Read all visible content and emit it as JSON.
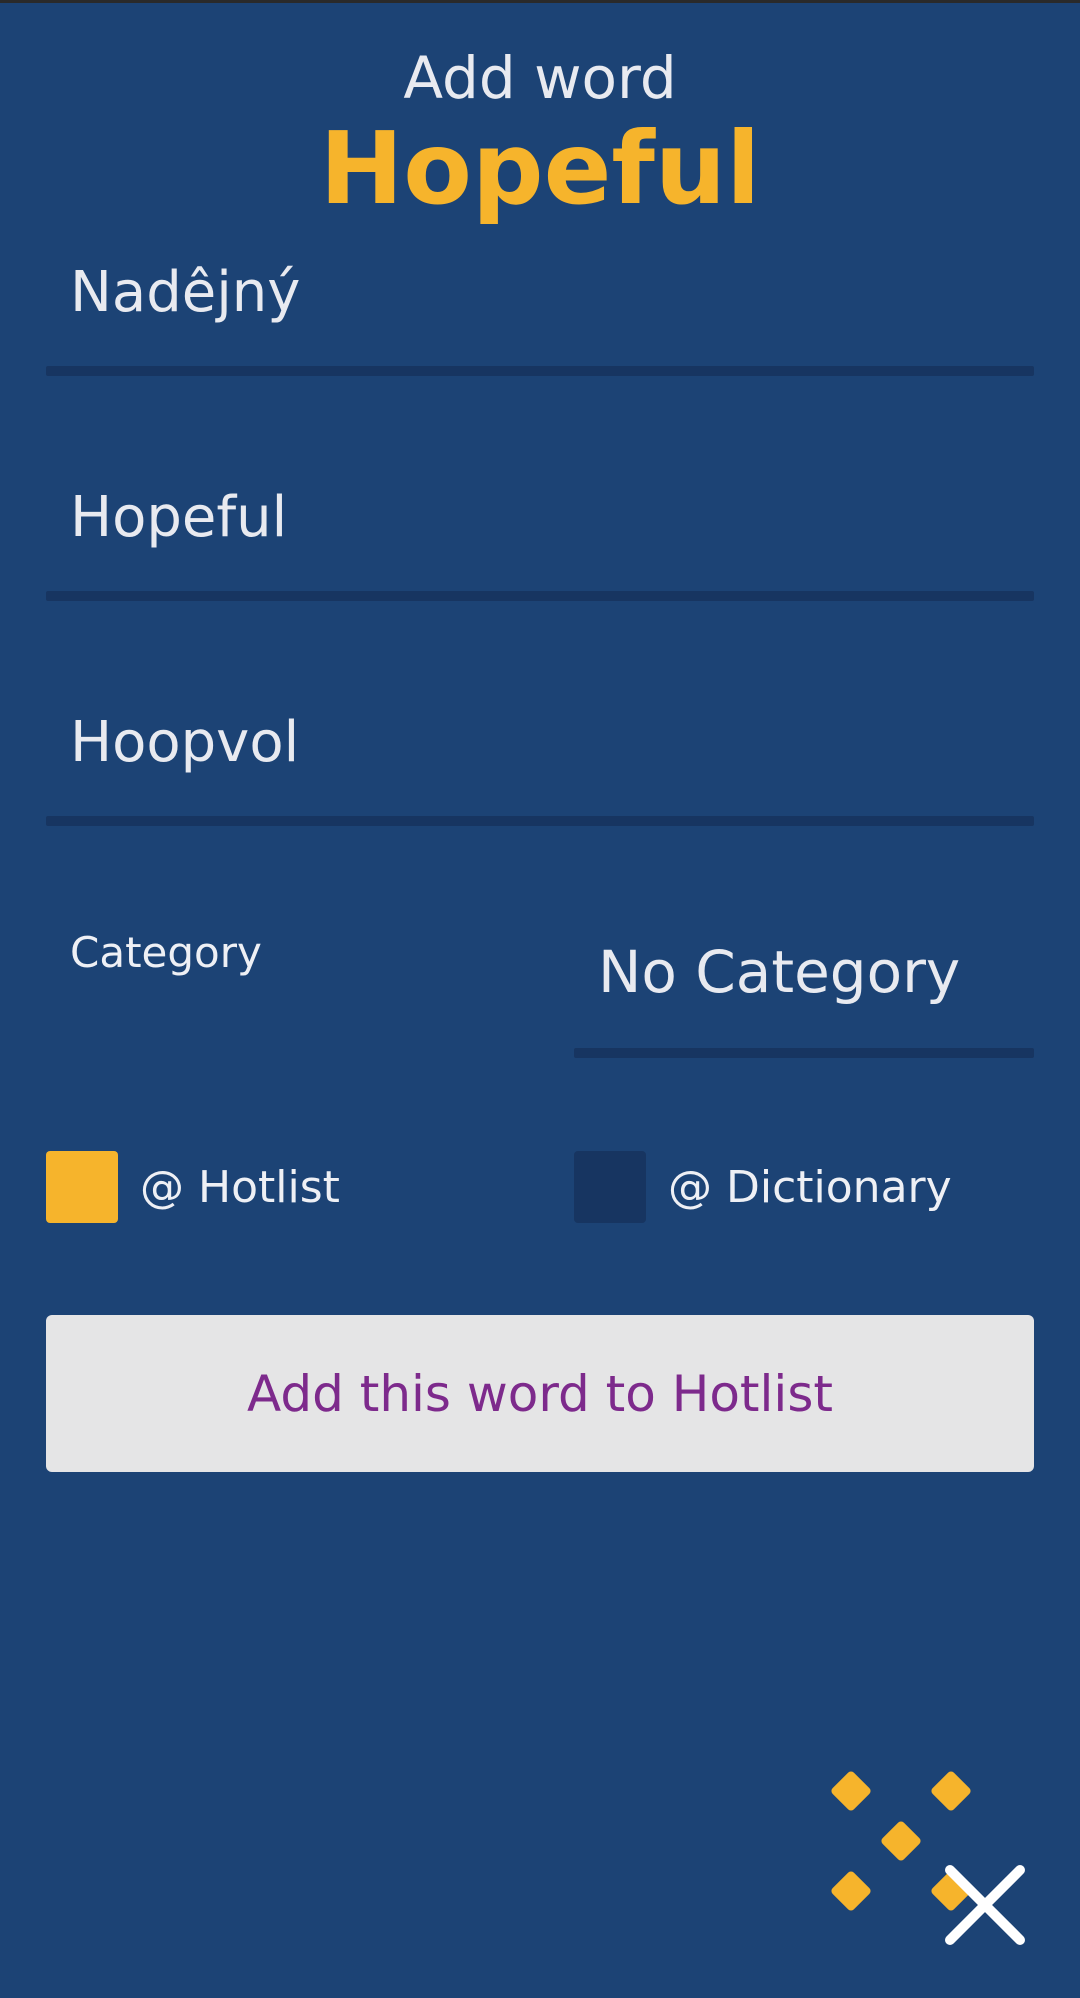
{
  "header": {
    "title": "Add word",
    "word": "Hopeful"
  },
  "fields": [
    {
      "value": "Nadêjný"
    },
    {
      "value": "Hopeful"
    },
    {
      "value": "Hoopvol"
    }
  ],
  "category": {
    "label": "Category",
    "value": "No Category"
  },
  "options": {
    "hotlist": {
      "label": "@ Hotlist",
      "checked": true
    },
    "dictionary": {
      "label": "@ Dictionary",
      "checked": false
    }
  },
  "button": {
    "label": "Add this word to Hotlist"
  },
  "icons": {
    "logo": "diamond-pattern-logo",
    "close": "close-icon"
  },
  "colors": {
    "background": "#1c4375",
    "accent": "#f6b42c",
    "button_text": "#7d2a8c",
    "button_bg": "#e5e5e6"
  }
}
